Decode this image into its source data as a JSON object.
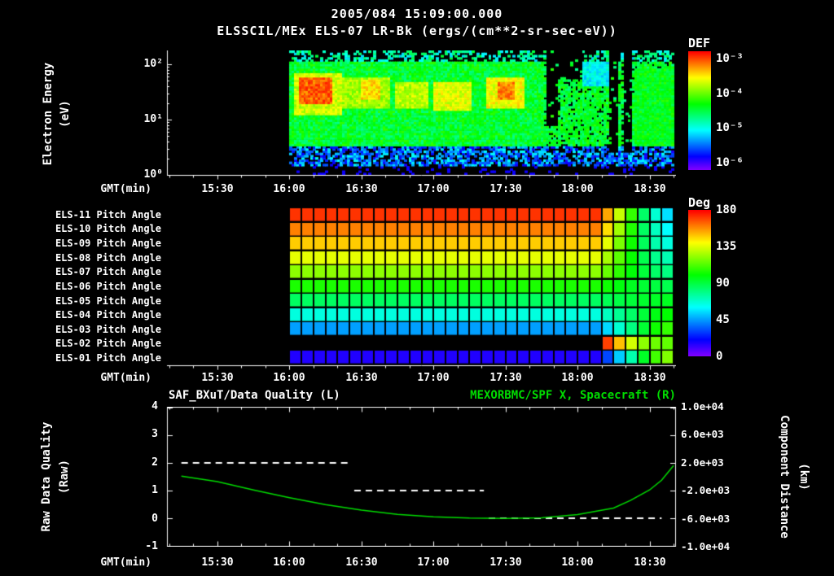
{
  "app": {
    "title_datetime": "2005/084 15:09:00.000",
    "title_instrument": "ELSSCIL/MEx ELS-07 LR-Bk  (ergs/(cm**2-sr-sec-eV))"
  },
  "time_axis": {
    "label": "GMT(min)",
    "start": "15:09",
    "end": "18:41",
    "ticks": [
      "15:30",
      "16:00",
      "16:30",
      "17:00",
      "17:30",
      "18:00",
      "18:30"
    ]
  },
  "colors": {
    "background": "#000000",
    "axis": "#ffffff",
    "spacecraft_green": "#00dd00"
  },
  "chart_data": [
    {
      "type": "heatmap",
      "name": "electron-energy-spectrogram",
      "title": "ELSSCIL/MEx ELS-07 LR-Bk",
      "units": "(ergs/(cm**2-sr-sec-eV))",
      "xlabel": "GMT(min)",
      "ylabel": {
        "line1": "Electron Energy",
        "line2": "(eV)"
      },
      "y_scale": "log",
      "y_ticks": [
        "10²",
        "10¹",
        "10⁰"
      ],
      "y_range_ev": [
        1,
        178
      ],
      "colorbar": {
        "title": "DEF",
        "scale": "log",
        "ticks": [
          "10⁻³",
          "10⁻⁴",
          "10⁻⁵",
          "10⁻⁶"
        ],
        "log_range": [
          -6,
          -3
        ]
      },
      "data_window": {
        "start": "16:00",
        "end": "18:40"
      },
      "base_band": {
        "e": [
          3.2,
          115
        ],
        "level": -4.45
      },
      "low_band": {
        "e": [
          1.5,
          3.2
        ],
        "level": -5.35
      },
      "high_band": {
        "e": [
          115,
          178
        ],
        "level": -4.8
      },
      "features": [
        {
          "t": [
            "16:02",
            "16:22"
          ],
          "e": [
            12,
            70
          ],
          "level": -3.8,
          "mode": "max"
        },
        {
          "t": [
            "16:04",
            "16:18"
          ],
          "e": [
            20,
            58
          ],
          "level": -3.25,
          "mode": "max"
        },
        {
          "t": [
            "16:22",
            "16:42"
          ],
          "e": [
            16,
            60
          ],
          "level": -3.9,
          "mode": "max"
        },
        {
          "t": [
            "16:30",
            "16:38"
          ],
          "e": [
            24,
            52
          ],
          "level": -3.6,
          "mode": "max"
        },
        {
          "t": [
            "16:44",
            "16:58"
          ],
          "e": [
            16,
            50
          ],
          "level": -3.85,
          "mode": "max"
        },
        {
          "t": [
            "17:00",
            "17:16"
          ],
          "e": [
            14,
            48
          ],
          "level": -3.75,
          "mode": "max"
        },
        {
          "t": [
            "17:22",
            "17:38"
          ],
          "e": [
            16,
            58
          ],
          "level": -3.7,
          "mode": "max"
        },
        {
          "t": [
            "17:27",
            "17:34"
          ],
          "e": [
            24,
            48
          ],
          "level": -3.35,
          "mode": "max"
        },
        {
          "t": [
            "17:47",
            "17:52"
          ],
          "e": [
            8,
            178
          ],
          "level": null,
          "mode": "gap"
        },
        {
          "t": [
            "17:52",
            "18:02"
          ],
          "e": [
            55,
            178
          ],
          "level": null,
          "mode": "gap"
        },
        {
          "t": [
            "18:02",
            "18:14"
          ],
          "e": [
            40,
            115
          ],
          "level": -5.0,
          "mode": "set"
        },
        {
          "t": [
            "18:13",
            "18:17"
          ],
          "e": [
            2.5,
            178
          ],
          "level": null,
          "mode": "gap"
        },
        {
          "t": [
            "18:19",
            "18:23"
          ],
          "e": [
            2.5,
            178
          ],
          "level": null,
          "mode": "gap"
        },
        {
          "t": [
            "18:24",
            "18:40"
          ],
          "e": [
            3.2,
            85
          ],
          "level": -4.4,
          "mode": "max"
        }
      ]
    },
    {
      "type": "heatmap",
      "name": "pitch-angle-panels",
      "colorbar": {
        "title": "Deg",
        "ticks": [
          "180",
          "135",
          "90",
          "45",
          "0"
        ],
        "range": [
          0,
          180
        ]
      },
      "cells": {
        "start": "16:00",
        "minutes_per_cell": 5,
        "count": 32,
        "tail_start_index": 26
      },
      "rows": [
        {
          "label": "ELS-11 Pitch Angle",
          "base": 172,
          "tail": [
            154,
            131,
            108,
            84,
            67,
            55
          ]
        },
        {
          "label": "ELS-10 Pitch Angle",
          "base": 160,
          "tail": [
            145,
            125,
            105,
            85,
            70,
            60
          ]
        },
        {
          "label": "ELS-09 Pitch Angle",
          "base": 148,
          "tail": [
            136,
            119,
            102,
            86,
            73,
            65
          ]
        },
        {
          "label": "ELS-08 Pitch Angle",
          "base": 136,
          "tail": [
            126,
            114,
            101,
            88,
            78,
            72
          ]
        },
        {
          "label": "ELS-07 Pitch Angle",
          "base": 122,
          "tail": [
            116,
            107,
            99,
            91,
            84,
            80
          ]
        },
        {
          "label": "ELS-06 Pitch Angle",
          "base": 104,
          "tail": [
            102,
            98,
            95,
            92,
            90,
            88
          ]
        },
        {
          "label": "ELS-05 Pitch Angle",
          "base": 85,
          "tail": [
            87,
            89,
            91,
            93,
            94,
            95
          ]
        },
        {
          "label": "ELS-04 Pitch Angle",
          "base": 65,
          "tail": [
            70,
            77,
            84,
            91,
            97,
            100
          ]
        },
        {
          "label": "ELS-03 Pitch Angle",
          "base": 45,
          "tail": [
            54,
            67,
            80,
            92,
            102,
            108
          ]
        },
        {
          "label": "ELS-02 Pitch Angle",
          "base": null,
          "tail": [
            170,
            150,
            133,
            122,
            117,
            115
          ]
        },
        {
          "label": "ELS-01 Pitch Angle",
          "base": 15,
          "tail": [
            31,
            52,
            73,
            94,
            110,
            120
          ]
        }
      ]
    },
    {
      "type": "line",
      "name": "quality-and-spacecraft-distance",
      "title_left": "SAF_BXuT/Data Quality (L)",
      "title_right": "MEXORBMC/SPF X, Spacecraft (R)",
      "xlabel": "GMT(min)",
      "ylabel_left": {
        "line1": "Raw Data Quality",
        "line2": "(Raw)"
      },
      "ylabel_right": {
        "line1": "Component Distance",
        "line2": "(km)"
      },
      "y_ticks_left": [
        "4",
        "3",
        "2",
        "1",
        "0",
        "-1"
      ],
      "ylim_left": [
        -1,
        4
      ],
      "y_ticks_right": [
        "1.0e+04",
        "6.0e+03",
        "2.0e+03",
        "-2.0e+03",
        "-6.0e+03",
        "-1.0e+04"
      ],
      "ylim_right": [
        -10000,
        10000
      ],
      "series": [
        {
          "name": "SAF_BXuT/Data Quality",
          "axis": "left",
          "style": "dashed",
          "color": "#ffffff",
          "segments": [
            {
              "value": 2,
              "start": "15:15",
              "end": "16:25"
            },
            {
              "value": 1,
              "start": "16:27",
              "end": "17:21"
            },
            {
              "value": 0,
              "start": "17:23",
              "end": "18:35"
            }
          ]
        },
        {
          "name": "MEXORBMC/SPF X Spacecraft",
          "axis": "right",
          "style": "solid",
          "color": "#00dd00",
          "points": [
            {
              "t": "15:15",
              "km": 100
            },
            {
              "t": "15:30",
              "km": -700
            },
            {
              "t": "15:45",
              "km": -1900
            },
            {
              "t": "16:00",
              "km": -3000
            },
            {
              "t": "16:15",
              "km": -4000
            },
            {
              "t": "16:30",
              "km": -4800
            },
            {
              "t": "16:45",
              "km": -5400
            },
            {
              "t": "17:00",
              "km": -5750
            },
            {
              "t": "17:15",
              "km": -5950
            },
            {
              "t": "17:30",
              "km": -6000
            },
            {
              "t": "17:45",
              "km": -5900
            },
            {
              "t": "18:00",
              "km": -5450
            },
            {
              "t": "18:15",
              "km": -4500
            },
            {
              "t": "18:22",
              "km": -3400
            },
            {
              "t": "18:30",
              "km": -1900
            },
            {
              "t": "18:35",
              "km": -500
            },
            {
              "t": "18:40",
              "km": 1600
            }
          ]
        }
      ]
    }
  ]
}
